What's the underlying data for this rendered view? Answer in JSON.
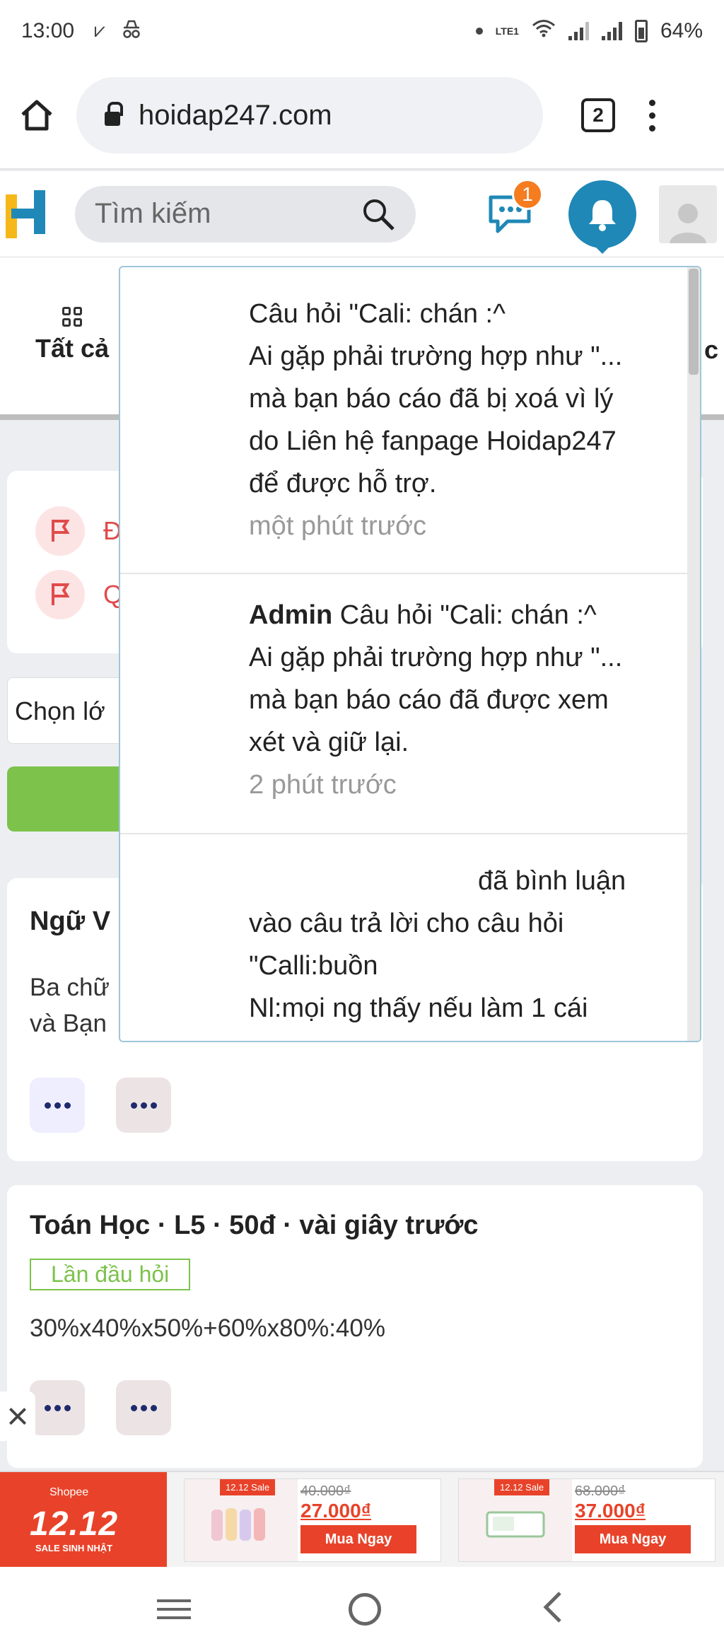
{
  "status_bar": {
    "time": "13:00",
    "network": "LTE1",
    "battery": "64%"
  },
  "browser": {
    "url": "hoidap247.com",
    "tab_count": "2"
  },
  "header": {
    "search_placeholder": "Tìm kiếm",
    "message_badge": "1"
  },
  "page": {
    "category_all": "Tất cả",
    "category_right_fragment": "c",
    "flag_item_1": "Đ",
    "flag_item_2": "Q",
    "class_select": "Chọn lớ",
    "card1": {
      "title": "Ngữ V",
      "body_line1": "Ba chữ",
      "body_line2": "và Bạn"
    },
    "card2": {
      "title": "Toán Học · L5 · 50đ · vài giây trước",
      "tag": "Lần đầu hỏi",
      "body": "30%x40%x50%+60%x80%:40%"
    }
  },
  "notifications": [
    {
      "actor": "",
      "line1": "Câu hỏi \"Cali: chán :^",
      "line2": "Ai gặp phải trường hợp như \"...",
      "line3": "mà bạn báo cáo đã bị xoá vì lý",
      "line4": "do Liên hệ fanpage Hoidap247",
      "line5": "để được hỗ trợ.",
      "time": "một phút trước"
    },
    {
      "actor": "Admin",
      "line1": "Câu hỏi \"Cali: chán :^",
      "line2": "Ai gặp phải trường hợp như \"...",
      "line3": "mà bạn báo cáo đã được xem",
      "line4": "xét và giữ lại.",
      "time": "2 phút trước"
    },
    {
      "line1": "đã bình luận",
      "line2": "vào câu trả lời cho câu hỏi",
      "line3": "\"Calli:buồn",
      "line4": "Nl:mọi ng thấy nếu làm 1 cái"
    }
  ],
  "ad": {
    "brand": "Shopee",
    "headline": "12.12",
    "sub": "SALE SINH NHẬT",
    "items": [
      {
        "tag": "12.12 Sale",
        "old_price": "40.000₫",
        "new_price": "27.000₫",
        "button": "Mua Ngay"
      },
      {
        "tag": "12.12 Sale",
        "old_price": "68.000₫",
        "new_price": "37.000₫",
        "button": "Mua Ngay"
      }
    ]
  },
  "colors": {
    "accent": "#1f88b6",
    "badge": "#f57c1f",
    "green": "#7cc24b",
    "shopee": "#e8432a"
  }
}
